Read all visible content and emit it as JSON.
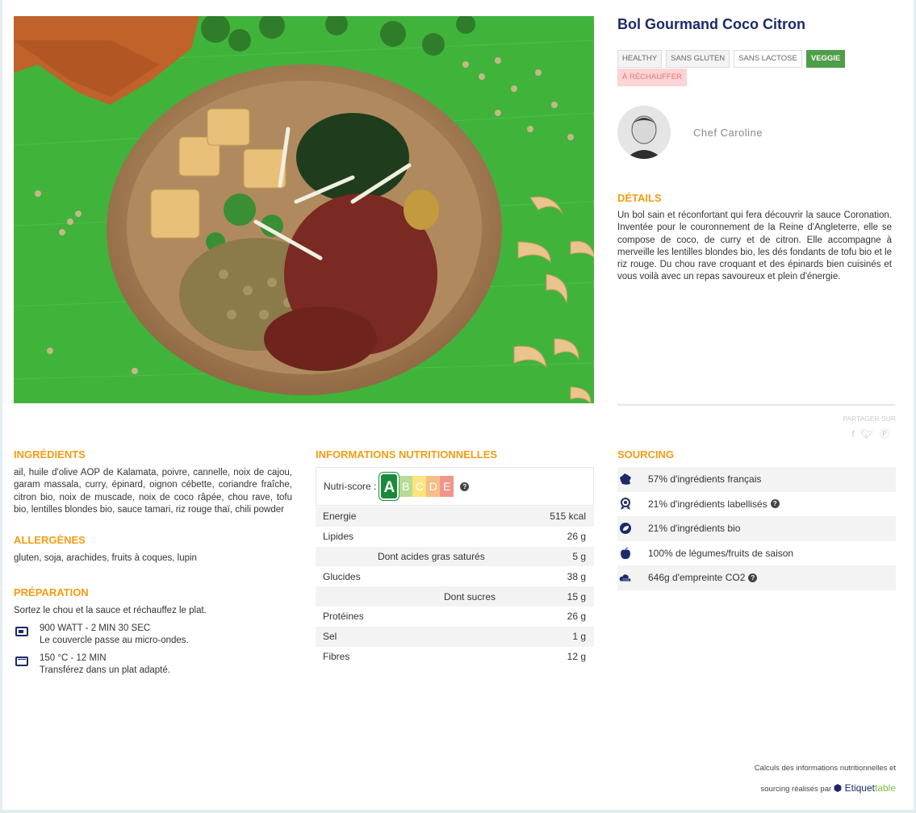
{
  "title": "Bol Gourmand Coco Citron",
  "tags": [
    "HEALTHY",
    "SANS GLUTEN",
    "SANS LACTOSE",
    "VEGGIE",
    "À RÉCHAUFFER"
  ],
  "chef": {
    "name": "Chef Caroline"
  },
  "details": {
    "heading": "DÉTAILS",
    "text": "Un bol sain et réconfortant qui fera découvrir la sauce Coronation. Inventée pour le couronnement de la Reine d'Angleterre, elle se compose de coco, de curry et de citron. Elle accompagne à merveille les lentilles blondes bio, les dés fondants de tofu bio et le riz rouge. Du chou rave croquant et des épinards bien cuisinés et vous voilà avec un repas savoureux et plein d'énergie."
  },
  "share": {
    "label": "PARTAGER SUR",
    "icons": [
      "facebook-icon",
      "twitter-icon",
      "pinterest-icon"
    ]
  },
  "ingredients": {
    "heading": "INGRÉDIENTS",
    "text": "ail, huile d'olive AOP de Kalamata, poivre, cannelle, noix de cajou, garam massala, curry, épinard, oignon cébette, coriandre fraîche, citron bio, noix de muscade, noix de coco râpée, chou rave, tofu bio, lentilles blondes bio, sauce tamari, riz rouge thaï, chili powder"
  },
  "allergens": {
    "heading": "ALLERGÈNES",
    "text": "gluten, soja, arachides, fruits à coques, lupin"
  },
  "preparation": {
    "heading": "PRÉPARATION",
    "intro": "Sortez le chou et la sauce et réchauffez le plat.",
    "steps": [
      {
        "icon": "microwave-icon",
        "line1": "900 WATT - 2 MIN 30 SEC",
        "line2": "Le couvercle passe au micro-ondes."
      },
      {
        "icon": "oven-icon",
        "line1": "150 °C - 12 MIN",
        "line2": "Transférez dans un plat adapté."
      }
    ]
  },
  "nutrition": {
    "heading": "INFORMATIONS NUTRITIONNELLES",
    "nutriscore_label": "Nutri-score :",
    "nutriscore_value": "A",
    "nutriscore_scale": [
      {
        "letter": "A",
        "color": "#1b8a3d"
      },
      {
        "letter": "B",
        "color": "#7bc043"
      },
      {
        "letter": "C",
        "color": "#f7d117"
      },
      {
        "letter": "D",
        "color": "#ef8a24"
      },
      {
        "letter": "E",
        "color": "#e5412d"
      }
    ],
    "rows": [
      {
        "name": "Energie",
        "value": "515 kcal"
      },
      {
        "name": "Lipides",
        "value": "26 g"
      },
      {
        "name": "Dont acides gras saturés",
        "value": "5 g"
      },
      {
        "name": "Glucides",
        "value": "38 g"
      },
      {
        "name": "Dont sucres",
        "value": "15 g"
      },
      {
        "name": "Protéines",
        "value": "26 g"
      },
      {
        "name": "Sel",
        "value": "1 g"
      },
      {
        "name": "Fibres",
        "value": "12 g"
      }
    ]
  },
  "sourcing": {
    "heading": "SOURCING",
    "items": [
      {
        "icon": "france-map-icon",
        "text": "57% d'ingrédients français"
      },
      {
        "icon": "label-medal-icon",
        "text": "21% d'ingrédients labellisés"
      },
      {
        "icon": "organic-leaf-icon",
        "text": "21% d'ingrédients bio"
      },
      {
        "icon": "apple-icon",
        "text": "100% de légumes/fruits de saison"
      },
      {
        "icon": "co2-cloud-icon",
        "text": "646g d'empreinte CO2"
      }
    ]
  },
  "footer": {
    "line1": "Calculs des informations nutritionnelles et",
    "line2": "sourcing réalisés par",
    "brand_a": "Etiquet",
    "brand_b": "table"
  },
  "colors": {
    "title": "#1c2a6b",
    "section": "#f39c12",
    "veggie": "#4e9e47",
    "heat": "#fcd4d6"
  }
}
